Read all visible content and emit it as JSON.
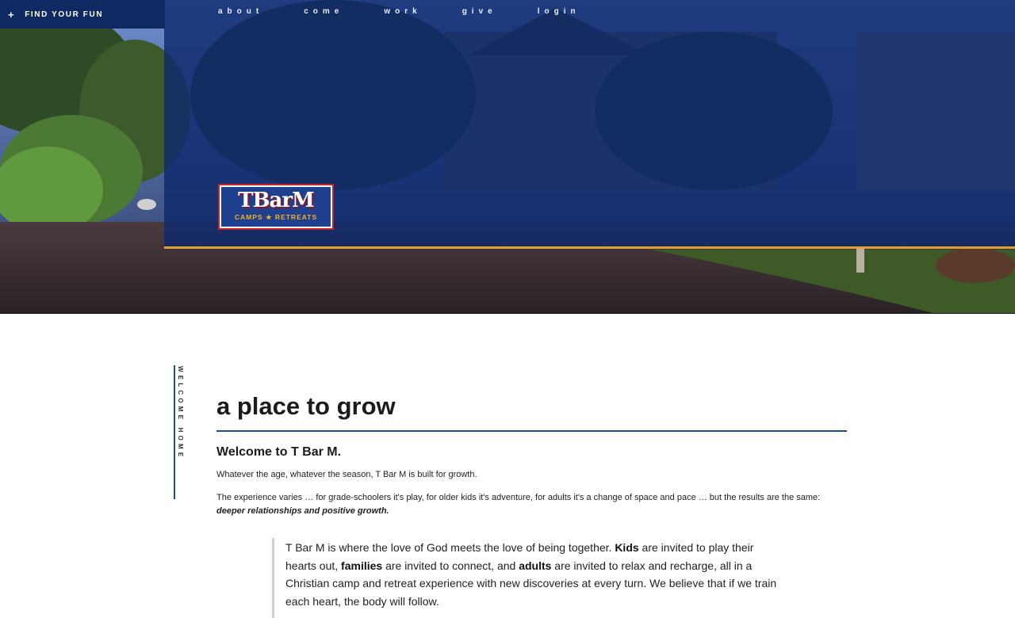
{
  "topbar": {
    "find_fun_label": "FIND YOUR FUN",
    "find_fun_icon": "plus-icon"
  },
  "nav": {
    "items": [
      {
        "label": "about"
      },
      {
        "label": "come"
      },
      {
        "label": "work"
      },
      {
        "label": "give"
      },
      {
        "label": "login"
      }
    ]
  },
  "brand": {
    "logo_main": "TBarM",
    "logo_sub": "CAMPS ★ RETREATS",
    "colors": {
      "navy": "#0f2a63",
      "panel": "#0e2a6e",
      "accent_gold": "#e0a030",
      "logo_red": "#c9242b",
      "logo_gold": "#f3b21e"
    }
  },
  "main": {
    "side_label": "WELCOME HOME",
    "headline": "a place to grow",
    "welcome": "Welcome to T Bar M.",
    "paragraph1": "Whatever the age, whatever the season, T Bar M is built for growth.",
    "paragraph2": {
      "text": "The experience varies … for grade-schoolers it's play, for older kids it's adventure, for adults it's a change of space and pace … but the results are the same: ",
      "emphasis": "deeper relationships and positive growth."
    },
    "quote": {
      "t1": "T Bar M is where the love of God meets the love of being together.  ",
      "b1": "Kids",
      "t2": " are invited to play their hearts out, ",
      "b2": "families",
      "t3": " are invited to connect, and ",
      "b3": "adults",
      "t4": " are invited to relax and recharge, all in a Christian camp and retreat experience with new discoveries at every turn. We believe that if we train each heart, the body will follow."
    }
  }
}
